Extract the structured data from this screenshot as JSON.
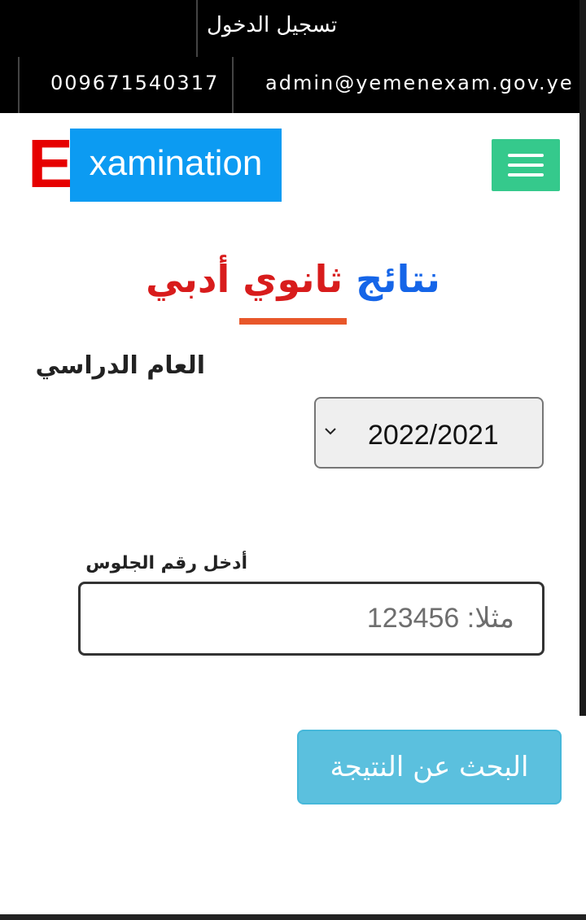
{
  "topbar": {
    "login": "تسجيل الدخول",
    "phone": "009671540317",
    "email": "admin@yemenexam.gov.ye"
  },
  "logo": {
    "first_letter": "E",
    "rest": "xamination",
    "colors": {
      "letter": "#e60000",
      "box": "#0c9bf2"
    }
  },
  "menu": {
    "icon": "hamburger-icon",
    "color": "#35c98c"
  },
  "heading": {
    "part1": "نتائج",
    "part2": "ثانوي",
    "part3": "أدبي",
    "colors": {
      "part1": "#1565e8",
      "part2": "#d81c1c",
      "part3": "#d81c1c",
      "underline": "#e8572a"
    }
  },
  "form": {
    "year_label": "العام الدراسي",
    "year_selected": "2022/2021",
    "seat_label": "أدخل رقم الجلوس",
    "seat_placeholder": "مثلا: 123456",
    "seat_value": "",
    "submit_label": "البحث عن النتيجة",
    "submit_color": "#5bc0de"
  }
}
